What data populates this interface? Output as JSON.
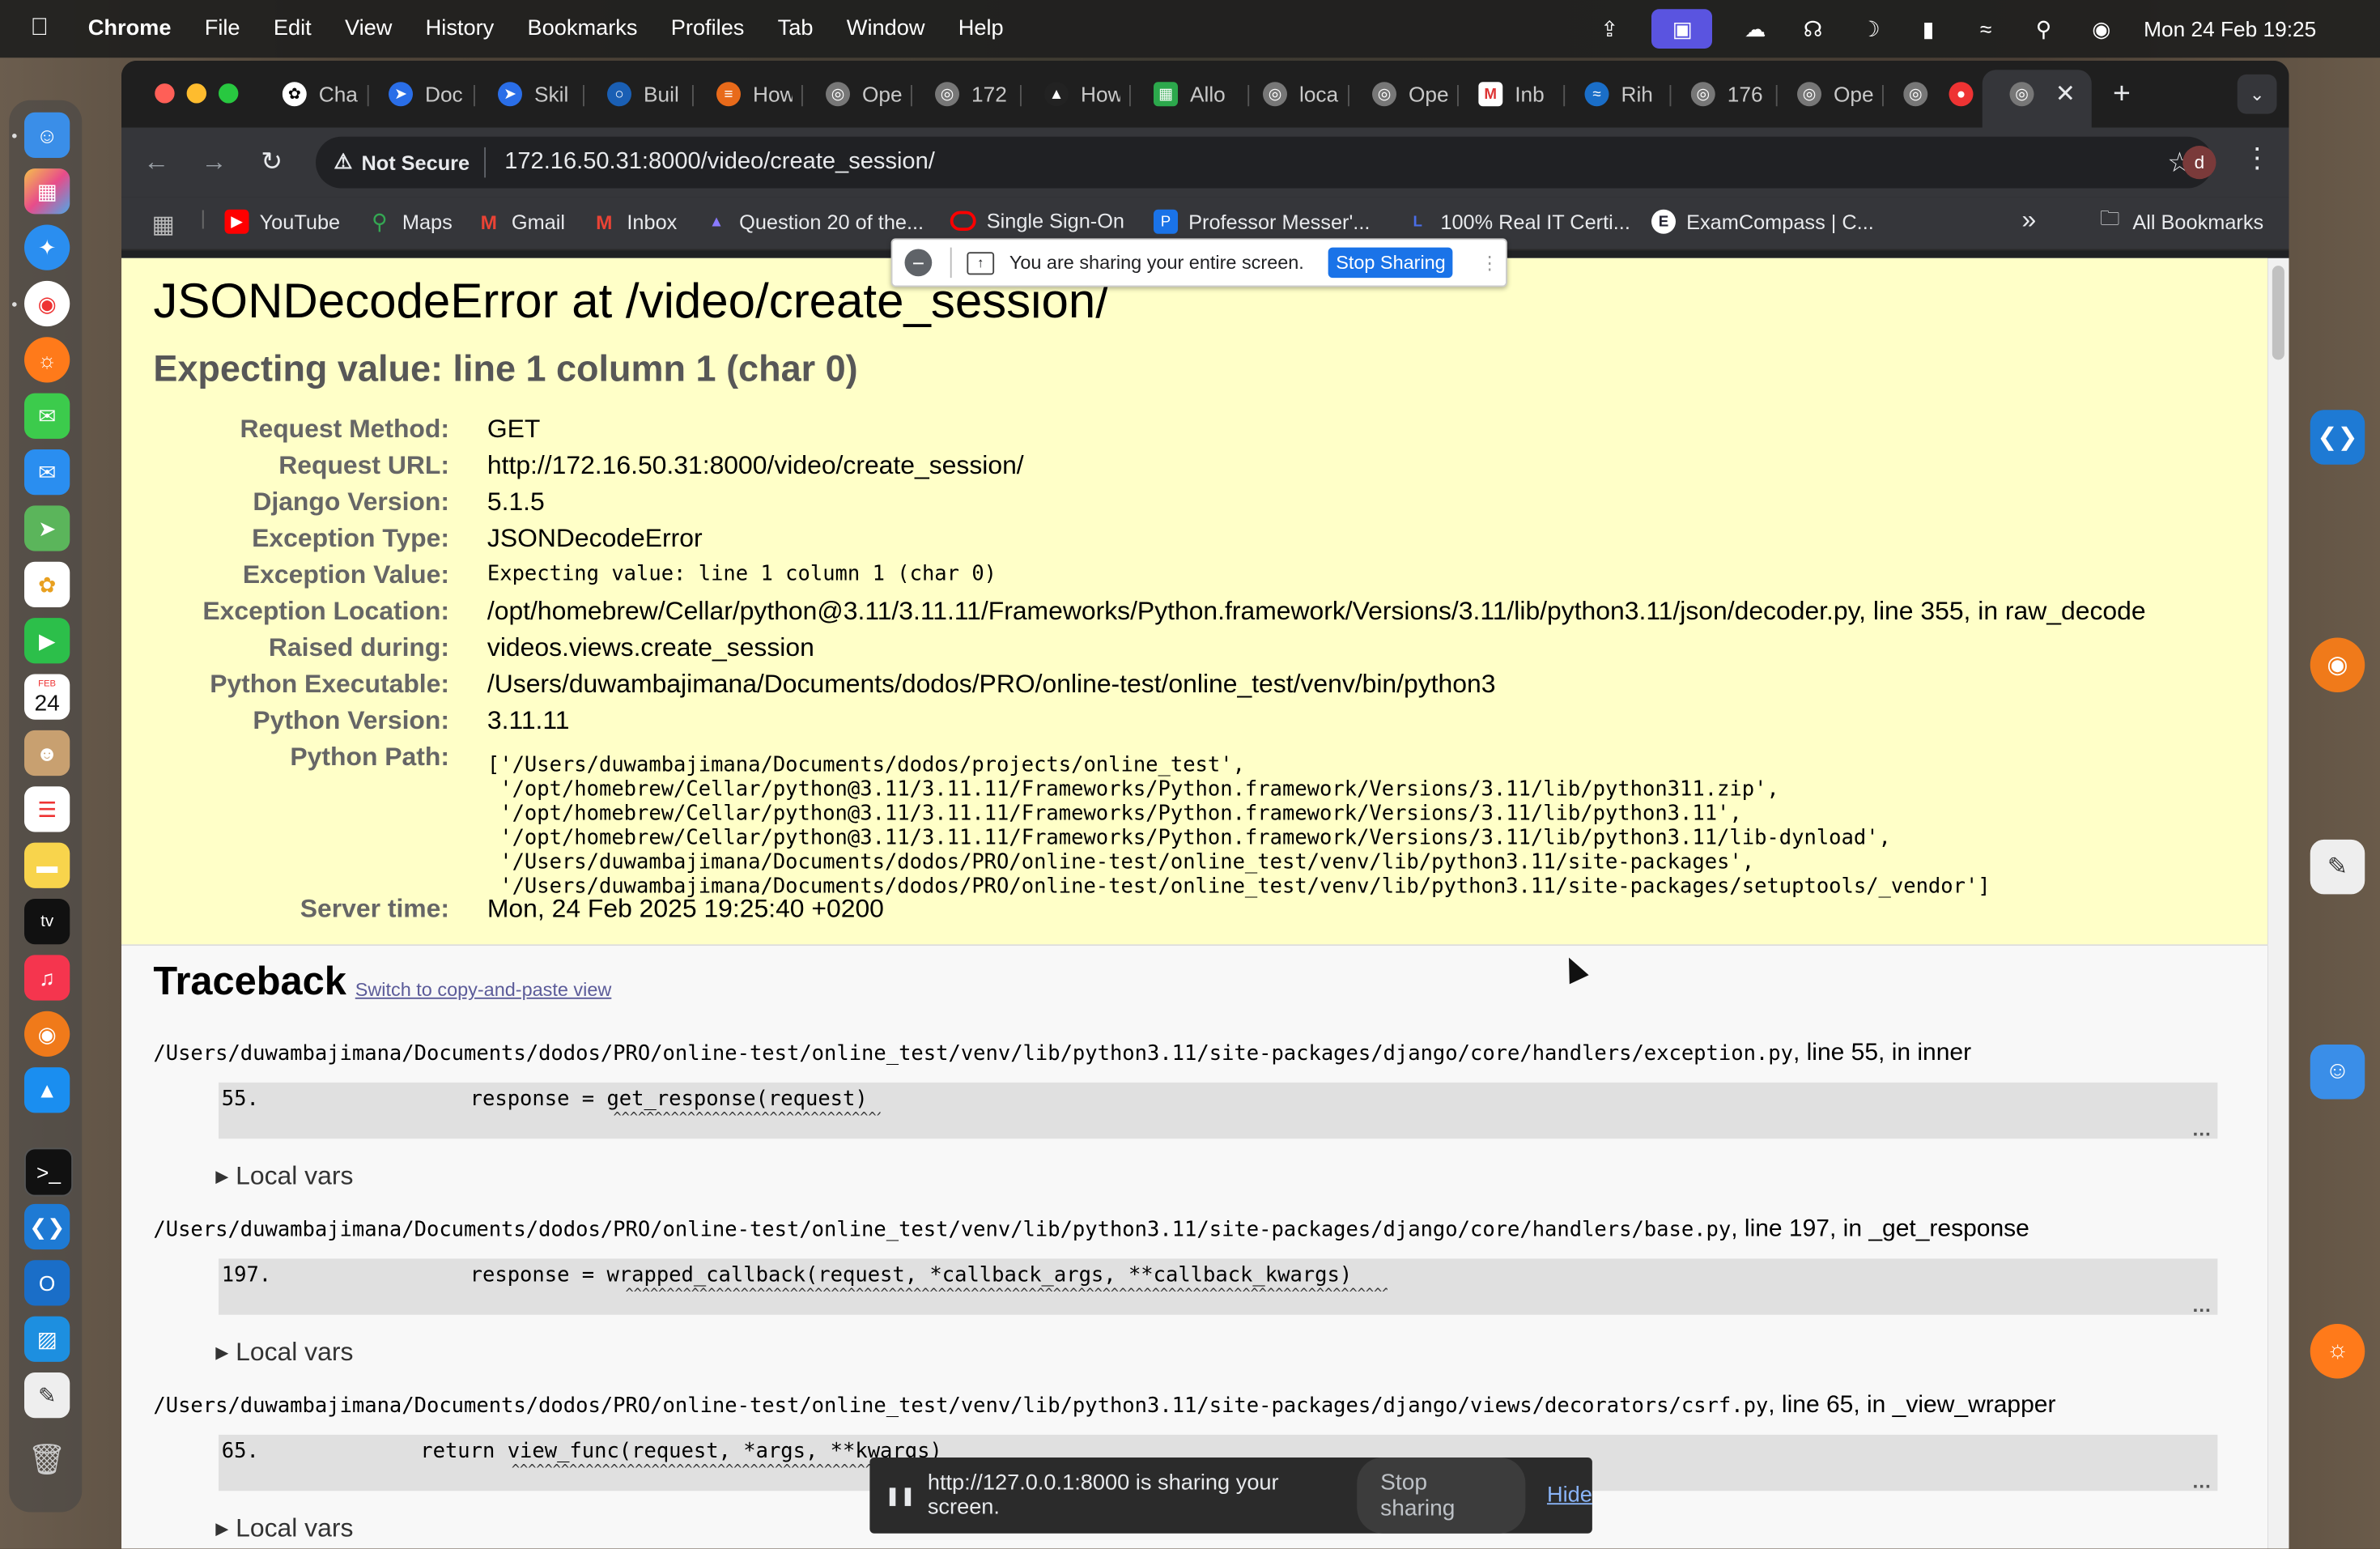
{
  "menubar": {
    "app_name": "Chrome",
    "menus": [
      "File",
      "Edit",
      "View",
      "History",
      "Bookmarks",
      "Profiles",
      "Tab",
      "Window",
      "Help"
    ],
    "datetime": "Mon 24 Feb  19:25"
  },
  "dock": {
    "calendar_month": "FEB",
    "calendar_day": "24",
    "tv_label": "tv"
  },
  "tabs": [
    "Cha",
    "Doc",
    "Skil",
    "Buil",
    "How",
    "Ope",
    "172",
    "How",
    "Allo",
    "loca",
    "Ope",
    "Inb",
    "Rih",
    "176",
    "Ope",
    "",
    "",
    ""
  ],
  "toolbar": {
    "not_secure": "Not Secure",
    "url": "172.16.50.31:8000/video/create_session/",
    "profile_initial": "d"
  },
  "bookmarks": {
    "items": [
      "YouTube",
      "Maps",
      "Gmail",
      "Inbox",
      "Question 20 of the...",
      "Single Sign-On",
      "Professor Messer'...",
      "100% Real IT Certi...",
      "ExamCompass | C..."
    ],
    "more": "»",
    "all": "All Bookmarks"
  },
  "share_bar": {
    "message": "You are sharing your entire screen.",
    "stop": "Stop Sharing"
  },
  "error": {
    "title": "JSONDecodeError at /video/create_session/",
    "subtitle": "Expecting value: line 1 column 1 (char 0)",
    "meta": [
      {
        "label": "Request Method:",
        "value": "GET"
      },
      {
        "label": "Request URL:",
        "value": "http://172.16.50.31:8000/video/create_session/"
      },
      {
        "label": "Django Version:",
        "value": "5.1.5"
      },
      {
        "label": "Exception Type:",
        "value": "JSONDecodeError"
      },
      {
        "label": "Exception Value:",
        "value": "Expecting value: line 1 column 1 (char 0)"
      },
      {
        "label": "Exception Location:",
        "value": "/opt/homebrew/Cellar/python@3.11/3.11.11/Frameworks/Python.framework/Versions/3.11/lib/python3.11/json/decoder.py, line 355, in raw_decode"
      },
      {
        "label": "Raised during:",
        "value": "videos.views.create_session"
      },
      {
        "label": "Python Executable:",
        "value": "/Users/duwambajimana/Documents/dodos/PRO/online-test/online_test/venv/bin/python3"
      },
      {
        "label": "Python Version:",
        "value": "3.11.11"
      },
      {
        "label": "Python Path:",
        "value": ""
      },
      {
        "label": "Server time:",
        "value": "Mon, 24 Feb 2025 19:25:40 +0200"
      }
    ],
    "python_path": "['/Users/duwambajimana/Documents/dodos/projects/online_test',\n '/opt/homebrew/Cellar/python@3.11/3.11.11/Frameworks/Python.framework/Versions/3.11/lib/python311.zip',\n '/opt/homebrew/Cellar/python@3.11/3.11.11/Frameworks/Python.framework/Versions/3.11/lib/python3.11',\n '/opt/homebrew/Cellar/python@3.11/3.11.11/Frameworks/Python.framework/Versions/3.11/lib/python3.11/lib-dynload',\n '/Users/duwambajimana/Documents/dodos/PRO/online-test/online_test/venv/lib/python3.11/site-packages',\n '/Users/duwambajimana/Documents/dodos/PRO/online-test/online_test/venv/lib/python3.11/site-packages/setuptools/_vendor']"
  },
  "traceback": {
    "title": "Traceback",
    "switch_link": "Switch to copy-and-paste view",
    "local_vars": "Local vars",
    "frames": [
      {
        "path": "/Users/duwambajimana/Documents/dodos/PRO/online-test/online_test/venv/lib/python3.11/site-packages/django/core/handlers/exception.py",
        "suffix": ", line 55, in inner",
        "code": "55.                 response = get_response(request)"
      },
      {
        "path": "/Users/duwambajimana/Documents/dodos/PRO/online-test/online_test/venv/lib/python3.11/site-packages/django/core/handlers/base.py",
        "suffix": ", line 197, in _get_response",
        "code": "197.                response = wrapped_callback(request, *callback_args, **callback_kwargs)"
      },
      {
        "path": "/Users/duwambajimana/Documents/dodos/PRO/online-test/online_test/venv/lib/python3.11/site-packages/django/views/decorators/csrf.py",
        "suffix": ", line 65, in _view_wrapper",
        "code": "65.             return view_func(request, *args, **kwargs)"
      }
    ]
  },
  "share_notice": {
    "message": "http://127.0.0.1:8000 is sharing your screen.",
    "stop": "Stop sharing",
    "hide": "Hide"
  },
  "colors": {
    "summary_bg": "#ffffc8",
    "code_bg": "#e0e0e0",
    "share_blue": "#1a73e8",
    "chrome_dark": "#35363a"
  }
}
